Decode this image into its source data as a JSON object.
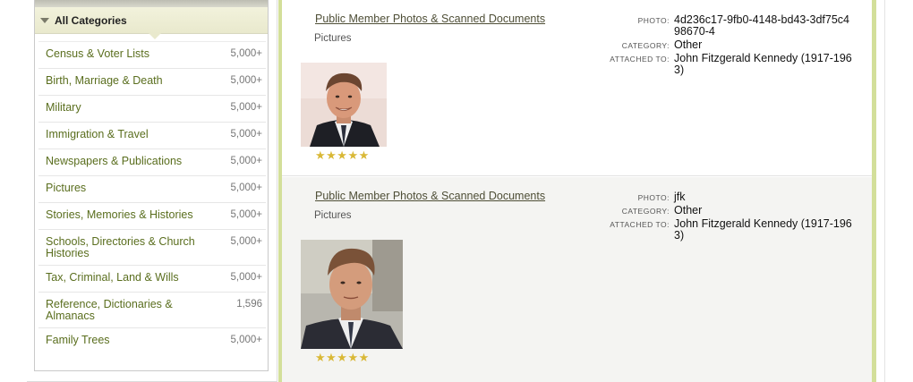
{
  "sidebar": {
    "header": "All Categories",
    "items": [
      {
        "label": "Census & Voter Lists",
        "count": "5,000+"
      },
      {
        "label": "Birth, Marriage & Death",
        "count": "5,000+"
      },
      {
        "label": "Military",
        "count": "5,000+"
      },
      {
        "label": "Immigration & Travel",
        "count": "5,000+"
      },
      {
        "label": "Newspapers & Publications",
        "count": "5,000+"
      },
      {
        "label": "Pictures",
        "count": "5,000+"
      },
      {
        "label": "Stories, Memories & Histories",
        "count": "5,000+"
      },
      {
        "label": "Schools, Directories & Church Histories",
        "count": "5,000+"
      },
      {
        "label": "Tax, Criminal, Land & Wills",
        "count": "5,000+"
      },
      {
        "label": "Reference, Dictionaries & Almanacs",
        "count": "1,596"
      },
      {
        "label": "Family Trees",
        "count": "5,000+"
      }
    ]
  },
  "records": [
    {
      "title": "Public Member Photos & Scanned Documents",
      "subtitle": "Pictures",
      "stars": "★★★★★",
      "rating": 5,
      "photo_label": "PHOTO:",
      "photo_value": "4d236c17-9fb0-4148-bd43-3df75c498670-4",
      "category_label": "CATEGORY:",
      "category_value": "Other",
      "attached_label": "ATTACHED TO:",
      "attached_value": "John Fitzgerald Kennedy (1917-1963)"
    },
    {
      "title": "Public Member Photos & Scanned Documents",
      "subtitle": "Pictures",
      "stars": "★★★★★",
      "rating": 5,
      "photo_label": "PHOTO:",
      "photo_value": "jfk",
      "category_label": "CATEGORY:",
      "category_value": "Other",
      "attached_label": "ATTACHED TO:",
      "attached_value": "John Fitzgerald Kennedy (1917-1963)"
    }
  ],
  "colors": {
    "accent_green": "#d3df9a",
    "link_olive": "#5a6e1e",
    "star_gold": "#d9b836",
    "header_bg": "#f2f2dc"
  },
  "icons": {
    "header_caret": "caret-down-icon",
    "rating": "star-icon"
  }
}
